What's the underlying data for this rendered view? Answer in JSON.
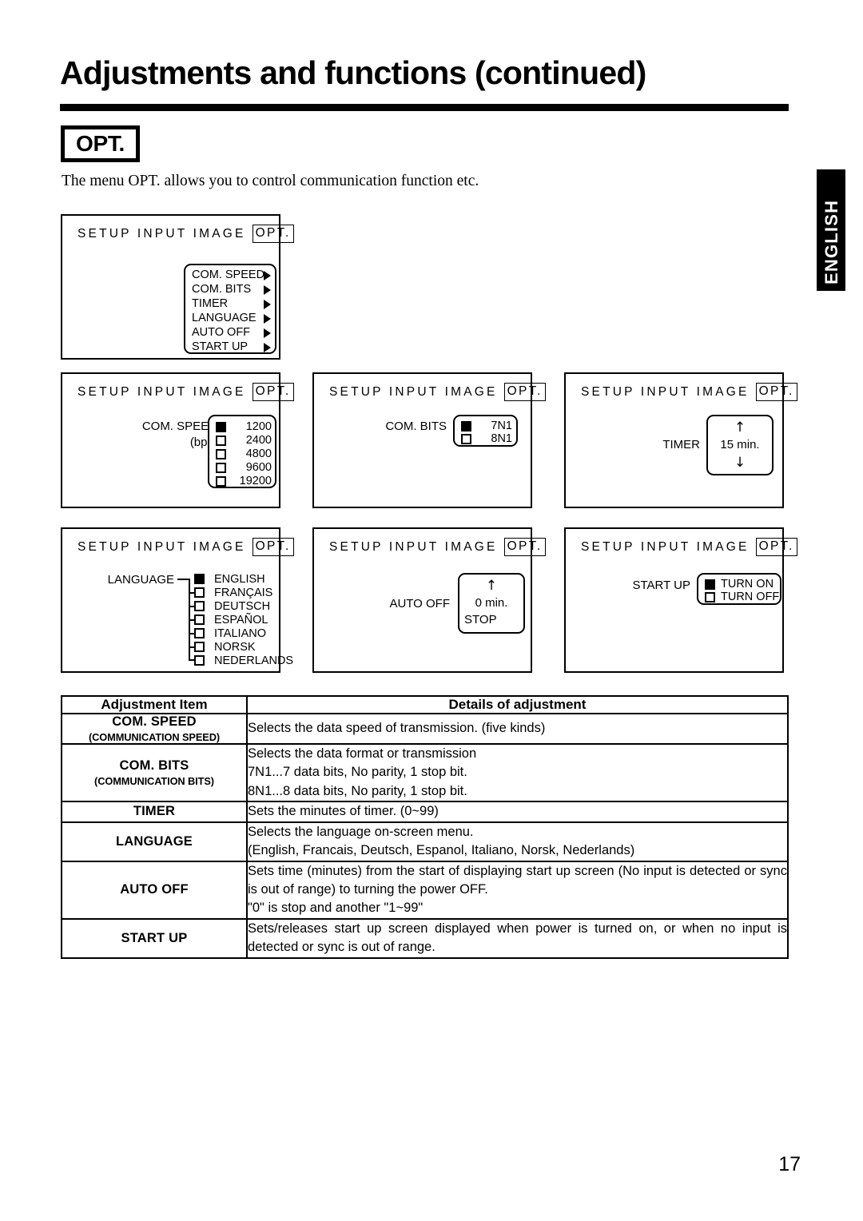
{
  "page": {
    "title": "Adjustments and functions (continued)",
    "section_badge": "OPT.",
    "intro": "The menu OPT. allows you to control communication function etc.",
    "side_tab": "ENGLISH",
    "page_number": "17"
  },
  "osd": {
    "header": {
      "tabs": "SETUP  INPUT  IMAGE",
      "active_tab": "OPT."
    },
    "menu_panel": {
      "items": [
        {
          "label": "COM. SPEED",
          "arrow": "right-arrow-icon"
        },
        {
          "label": "COM. BITS",
          "arrow": "right-arrow-icon"
        },
        {
          "label": "TIMER",
          "arrow": "right-arrow-icon"
        },
        {
          "label": "LANGUAGE",
          "arrow": "right-arrow-icon"
        },
        {
          "label": "AUTO  OFF",
          "arrow": "right-arrow-icon"
        },
        {
          "label": "START UP",
          "arrow": "right-arrow-icon"
        }
      ]
    },
    "com_speed_panel": {
      "label_line1": "COM. SPEED",
      "label_line2": "(bps)",
      "options": [
        {
          "value": "1200",
          "selected": true
        },
        {
          "value": "2400",
          "selected": false
        },
        {
          "value": "4800",
          "selected": false
        },
        {
          "value": "9600",
          "selected": false
        },
        {
          "value": "19200",
          "selected": false
        }
      ]
    },
    "com_bits_panel": {
      "label": "COM. BITS",
      "options": [
        {
          "value": "7N1",
          "selected": true
        },
        {
          "value": "8N1",
          "selected": false
        }
      ]
    },
    "timer_panel": {
      "label": "TIMER",
      "up_arrow": "↑",
      "value": "15  min.",
      "down_arrow": "↓"
    },
    "language_panel": {
      "label": "LANGUAGE",
      "options": [
        {
          "value": "ENGLISH",
          "selected": true
        },
        {
          "value": "FRANÇAIS",
          "selected": false
        },
        {
          "value": "DEUTSCH",
          "selected": false
        },
        {
          "value": "ESPAÑOL",
          "selected": false
        },
        {
          "value": "ITALIANO",
          "selected": false
        },
        {
          "value": "NORSK",
          "selected": false
        },
        {
          "value": "NEDERLANDS",
          "selected": false
        }
      ]
    },
    "auto_off_panel": {
      "label": "AUTO  OFF",
      "up_arrow": "↑",
      "value": "0  min.",
      "stop_label": "STOP"
    },
    "start_up_panel": {
      "label": "START UP",
      "options": [
        {
          "value": "TURN ON",
          "selected": true
        },
        {
          "value": "TURN OFF",
          "selected": false
        }
      ]
    }
  },
  "table": {
    "headers": {
      "item": "Adjustment Item",
      "details": "Details of adjustment"
    },
    "rows": [
      {
        "item": "COM. SPEED",
        "item_sub": "(COMMUNICATION SPEED)",
        "details": [
          "Selects the data speed of transmission. (five kinds)"
        ]
      },
      {
        "item": "COM. BITS",
        "item_sub": "(COMMUNICATION BITS)",
        "details": [
          "Selects the data format or transmission",
          "7N1...7 data bits, No parity, 1 stop bit.",
          "8N1...8 data bits, No parity, 1 stop bit."
        ]
      },
      {
        "item": "TIMER",
        "item_sub": "",
        "details": [
          "Sets the minutes of timer. (0~99)"
        ]
      },
      {
        "item": "LANGUAGE",
        "item_sub": "",
        "details": [
          "Selects the language on-screen menu.",
          "(English, Francais, Deutsch, Espanol, Italiano, Norsk, Nederlands)"
        ]
      },
      {
        "item": "AUTO OFF",
        "item_sub": "",
        "details": [
          "Sets time (minutes) from the start of displaying start up screen (No input is detected or sync is out of range) to turning the power OFF.",
          "\"0\" is stop and another \"1~99\""
        ],
        "justify": true
      },
      {
        "item": "START UP",
        "item_sub": "",
        "details": [
          "Sets/releases start up screen displayed when power is turned on, or when no input is detected or sync is out of range."
        ],
        "justify": true
      }
    ]
  }
}
